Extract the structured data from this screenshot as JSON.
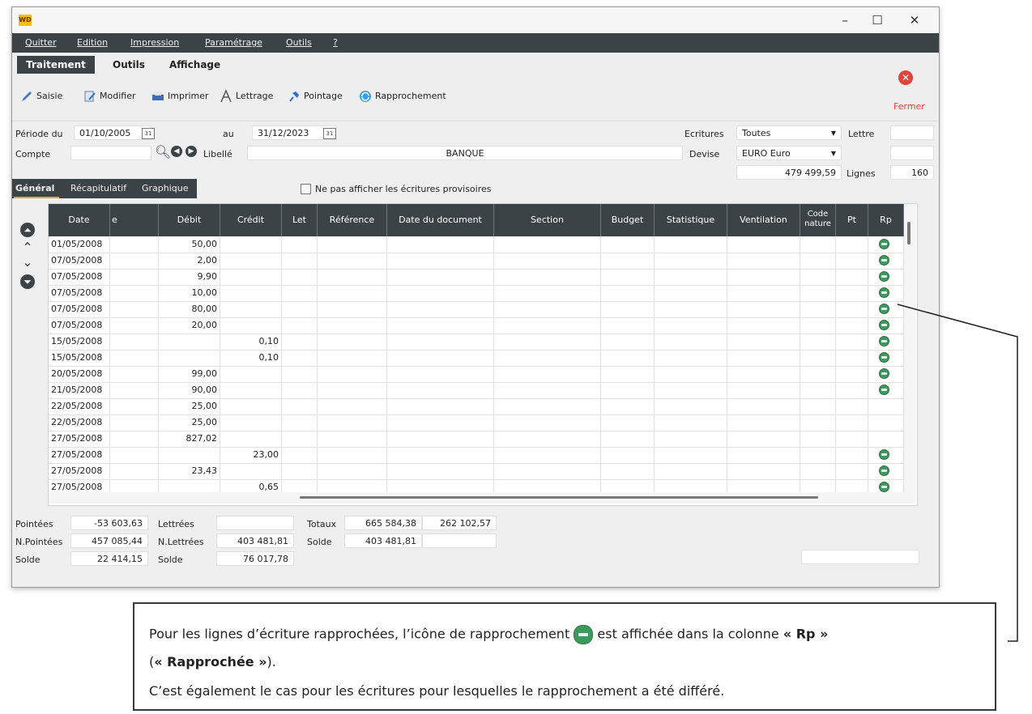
{
  "menu": [
    "Quitter",
    "Edition",
    "Impression",
    "Paramétrage",
    "Outils",
    "?"
  ],
  "ribbon_tabs": [
    "Traitement",
    "Outils",
    "Affichage"
  ],
  "toolbar": {
    "saisie": "Saisie",
    "modifier": "Modifier",
    "imprimer": "Imprimer",
    "lettrage": "Lettrage",
    "pointage": "Pointage",
    "rapprochement": "Rapprochement",
    "fermer": "Fermer"
  },
  "filters": {
    "periode_label": "Période du",
    "periode_from": "01/10/2005",
    "au_label": "au",
    "periode_to": "31/12/2023",
    "compte_label": "Compte",
    "compte_value": "",
    "libelle_label": "Libellé",
    "libelle_value": "BANQUE",
    "ecritures_label": "Ecritures",
    "ecritures_value": "Toutes",
    "lettre_label": "Lettre",
    "lettre_value": "",
    "devise_label": "Devise",
    "devise_value": "EURO Euro",
    "devise_extra": "",
    "montant": "479 499,59",
    "lignes_label": "Lignes",
    "lignes_value": "160",
    "provisoires_label": "Ne pas afficher les écritures provisoires",
    "cal_glyph": "31"
  },
  "subtabs": [
    "Général",
    "Récapitulatif",
    "Graphique"
  ],
  "columns": [
    "Date",
    "e",
    "Débit",
    "Crédit",
    "Let",
    "Référence",
    "Date du document",
    "Section",
    "Budget",
    "Statistique",
    "Ventilation",
    "Code nature",
    "Pt",
    "Rp"
  ],
  "rows": [
    {
      "date": "01/05/2008",
      "debit": "50,00",
      "credit": "",
      "rp": true
    },
    {
      "date": "07/05/2008",
      "debit": "2,00",
      "credit": "",
      "rp": true
    },
    {
      "date": "07/05/2008",
      "debit": "9,90",
      "credit": "",
      "rp": true
    },
    {
      "date": "07/05/2008",
      "debit": "10,00",
      "credit": "",
      "rp": true
    },
    {
      "date": "07/05/2008",
      "debit": "80,00",
      "credit": "",
      "rp": true
    },
    {
      "date": "07/05/2008",
      "debit": "20,00",
      "credit": "",
      "rp": true
    },
    {
      "date": "15/05/2008",
      "debit": "",
      "credit": "0,10",
      "rp": true
    },
    {
      "date": "15/05/2008",
      "debit": "",
      "credit": "0,10",
      "rp": true
    },
    {
      "date": "20/05/2008",
      "debit": "99,00",
      "credit": "",
      "rp": true
    },
    {
      "date": "21/05/2008",
      "debit": "90,00",
      "credit": "",
      "rp": true
    },
    {
      "date": "22/05/2008",
      "debit": "25,00",
      "credit": "",
      "rp": false
    },
    {
      "date": "22/05/2008",
      "debit": "25,00",
      "credit": "",
      "rp": false
    },
    {
      "date": "27/05/2008",
      "debit": "827,02",
      "credit": "",
      "rp": false
    },
    {
      "date": "27/05/2008",
      "debit": "",
      "credit": "23,00",
      "rp": true
    },
    {
      "date": "27/05/2008",
      "debit": "23,43",
      "credit": "",
      "rp": true
    },
    {
      "date": "27/05/2008",
      "debit": "",
      "credit": "0,65",
      "rp": true
    }
  ],
  "totals": {
    "pointees_label": "Pointées",
    "pointees": "-53 603,63",
    "npointees_label": "N.Pointées",
    "npointees": "457 085,44",
    "solde_label": "Solde",
    "solde1": "22 414,15",
    "lettrees_label": "Lettrées",
    "lettrees": "",
    "nlettrees_label": "N.Lettrées",
    "nlettrees": "403 481,81",
    "solde2": "76 017,78",
    "totaux_label": "Totaux",
    "totaux_debit": "665 584,38",
    "totaux_credit": "262 102,57",
    "solde_total": "403 481,81",
    "extra": ""
  },
  "note": {
    "line1_a": "Pour les lignes d’écriture rapprochées, l’icône de rapprochement",
    "line1_b": "est affichée dans la colonne",
    "line1_c": "« Rp »",
    "line2_a": "(",
    "line2_b": "« Rapprochée »",
    "line2_c": ").",
    "line3": "C’est également le cas pour les écritures pour lesquelles le rapprochement a été différé."
  },
  "colors": {
    "dark": "#3b4346",
    "close": "#e2433b",
    "rp_icon": "#3e9a5a"
  }
}
